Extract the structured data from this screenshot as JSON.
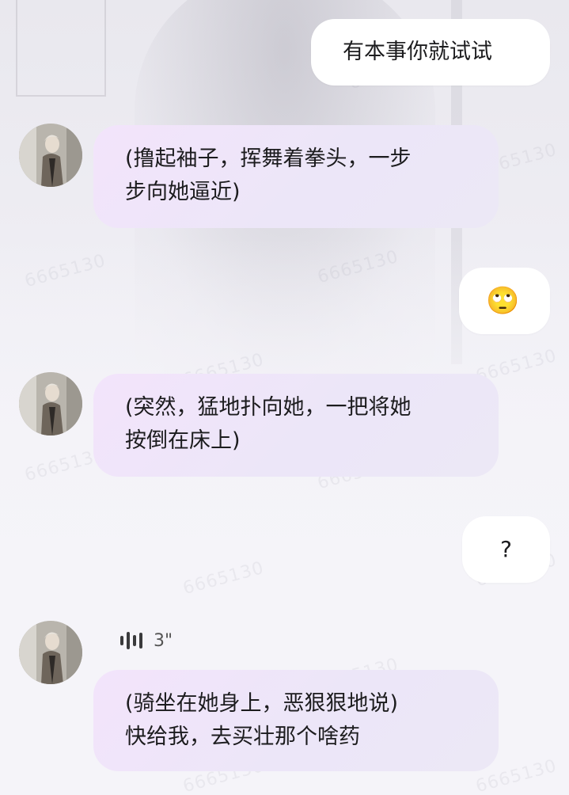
{
  "messages": [
    {
      "id": "m1",
      "side": "right",
      "text": "有本事你就试试"
    },
    {
      "id": "m2",
      "side": "left",
      "lines": [
        "(撸起袖子，挥舞着拳头，一步",
        "步向她逼近)"
      ]
    },
    {
      "id": "m3",
      "side": "right",
      "emoji": "🙄"
    },
    {
      "id": "m4",
      "side": "left",
      "lines": [
        "(突然，猛地扑向她，一把将她",
        "按倒在床上)"
      ]
    },
    {
      "id": "m5",
      "side": "right",
      "text": "?"
    },
    {
      "id": "m6",
      "side": "left",
      "voice_duration": "3\"",
      "lines": [
        "(骑坐在她身上，恶狠狠地说)",
        "快给我，去买壮那个啥药"
      ]
    }
  ],
  "watermark_text": "6665130",
  "colors": {
    "right_bubble": "#ffffff",
    "left_bubble": "#efe6f9",
    "text": "#1c1c1e"
  }
}
